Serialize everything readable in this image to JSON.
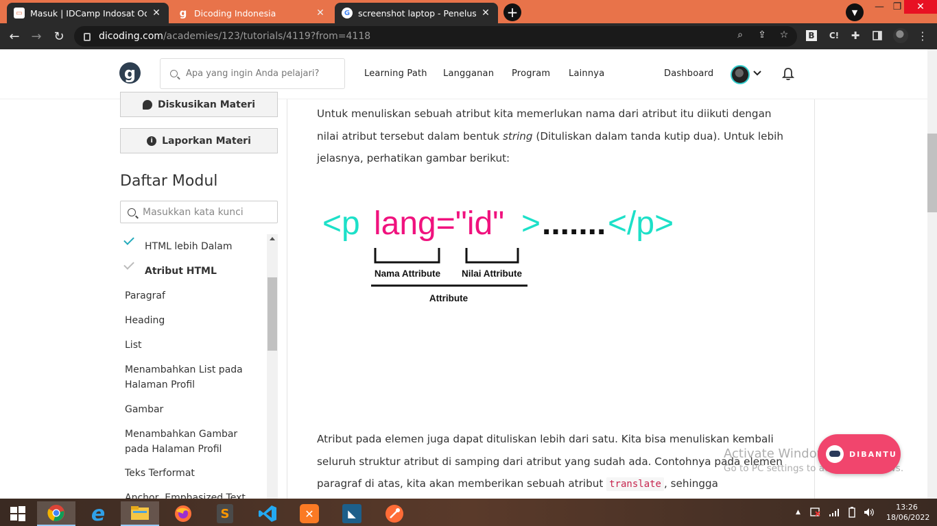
{
  "browser": {
    "tabs": [
      {
        "title": "Masuk | IDCamp Indosat Ooredo",
        "favicon": "idcamp-icon"
      },
      {
        "title": "Dicoding Indonesia",
        "favicon": "dicoding-icon"
      },
      {
        "title": "screenshot laptop - Penelusuran",
        "favicon": "google-icon"
      }
    ],
    "new_tab": "+",
    "close_glyph": "✕",
    "url_host": "dicoding.com",
    "url_path": "/academies/123/tutorials/4119?from=4118",
    "ext_b": "B",
    "ext_c": "C!"
  },
  "header": {
    "logo": "g",
    "search_placeholder": "Apa yang ingin Anda pelajari?",
    "nav": [
      "Learning Path",
      "Langganan",
      "Program",
      "Lainnya"
    ],
    "dashboard": "Dashboard"
  },
  "sidebar": {
    "diskusi": "Diskusikan Materi",
    "lapor": "Laporkan Materi",
    "daftar_title": "Daftar Modul",
    "keyword_placeholder": "Masukkan kata kunci",
    "modules": [
      {
        "label": "HTML lebih Dalam",
        "status": "done"
      },
      {
        "label": "Atribut HTML",
        "status": "current"
      },
      {
        "label": "Paragraf"
      },
      {
        "label": "Heading"
      },
      {
        "label": "List"
      },
      {
        "label": "Menambahkan List pada Halaman Profil"
      },
      {
        "label": "Gambar"
      },
      {
        "label": "Menambahkan Gambar pada Halaman Profil"
      },
      {
        "label": "Teks Terformat"
      },
      {
        "label": "Anchor, Emphasized Text"
      }
    ]
  },
  "content": {
    "p1_a": "Untuk menuliskan sebuah atribut kita memerlukan nama dari atribut itu diikuti dengan nilai atribut tersebut dalam bentuk ",
    "p1_em": "string",
    "p1_b": " (Dituliskan dalam tanda kutip dua). Untuk lebih jelasnya, perhatikan gambar berikut:",
    "figure": {
      "open_tag": "<p",
      "attr": "lang=\"id\"",
      "close_bracket": ">",
      "dots": ".......",
      "end_tag": "</p>",
      "label_name": "Nama Attribute",
      "label_value": "Nilai Attribute",
      "label_attr": "Attribute",
      "colors": {
        "tag": "#1de0c8",
        "attr": "#f0127e",
        "text": "#111111"
      }
    },
    "p2_a": "Atribut pada elemen juga dapat dituliskan lebih dari satu. Kita bisa menuliskan kembali seluruh struktur atribut di samping dari atribut yang sudah ada. Contohnya pada elemen paragraf di atas, kita akan memberikan sebuah atribut ",
    "p2_code": "translate",
    "p2_b": ", sehingga penulisannya"
  },
  "overlay": {
    "watermark_title": "Activate Windows",
    "watermark_sub": "Go to PC settings to activate Windows.",
    "help_button": "DIBANTU"
  },
  "taskbar": {
    "apps": [
      "windows-start-icon",
      "chrome-icon",
      "ie-icon",
      "file-explorer-icon",
      "firefox-icon",
      "sublime-icon",
      "vscode-icon",
      "xampp-icon",
      "mysql-workbench-icon",
      "postman-icon"
    ],
    "time": "13:26",
    "date": "18/06/2022"
  }
}
